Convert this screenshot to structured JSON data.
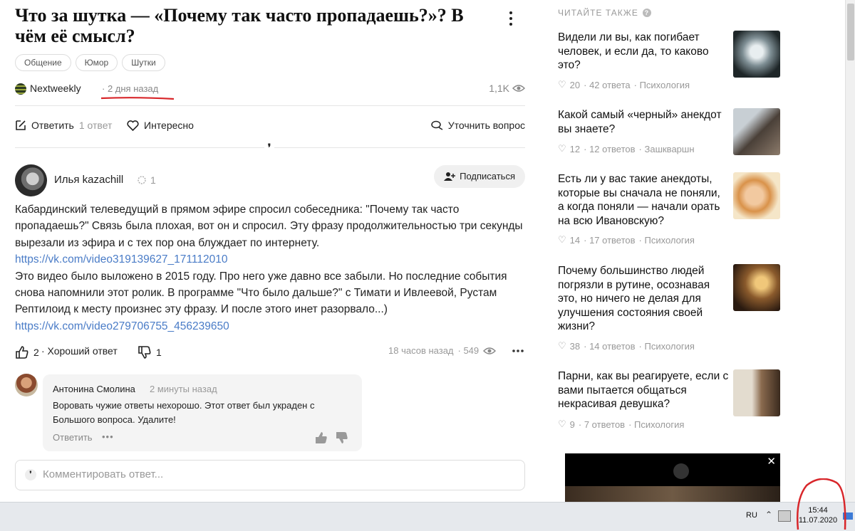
{
  "question": {
    "title": "Что за шутка — «Почему так часто пропадаешь?»? В чём её смысл?",
    "tags": [
      "Общение",
      "Юмор",
      "Шутки"
    ],
    "author": "Nextweekly",
    "time": "· 2 дня назад",
    "views": "1,1K"
  },
  "actions": {
    "answer_label": "Ответить",
    "answer_count": "1 ответ",
    "interesting_label": "Интересно",
    "clarify_label": "Уточнить вопрос"
  },
  "answer": {
    "author": "Илья kazachill",
    "rank": "1",
    "subscribe_label": "Подписаться",
    "paragraph1": "Кабардинский телеведущий в прямом эфире спросил собеседника: \"Почему так часто пропадаешь?\" Связь была плохая, вот он и спросил. Эту фразу продолжительностью три секунды вырезали из эфира и с тех пор она блуждает по интернету.",
    "link1": "https://vk.com/video319139627_171112010",
    "paragraph2": "Это видео было выложено в 2015 году. Про него уже давно все забыли. Но последние события снова напомнили этот ролик. В программе \"Что было дальше?\" с Тимати и Ивлеевой, Рустам Рептилоид к месту произнес эту фразу. И после этого инет разорвало...)",
    "link2": "https://vk.com/video279706755_456239650",
    "likes": "2",
    "good_answer_label": "· Хороший ответ",
    "dislikes": "1",
    "time": "18 часов назад",
    "views": "· 549"
  },
  "comment": {
    "author": "Антонина Смолина",
    "time": "2 минуты назад",
    "text": "Воровать чужие ответы нехорошо. Этот ответ был украден с Большого вопроса. Удалите!",
    "reply_label": "Ответить",
    "more": "•••"
  },
  "comment_input": {
    "placeholder": "Комментировать ответ..."
  },
  "sidebar": {
    "heading": "ЧИТАЙТЕ ТАКЖЕ",
    "items": [
      {
        "title": "Видели ли вы, как погибает человек, и если да, то каково это?",
        "likes": "20",
        "answers": "· 42 ответа",
        "category": "· Психология"
      },
      {
        "title": "Какой самый «черный» анекдот вы знаете?",
        "likes": "12",
        "answers": "· 12 ответов",
        "category": "· Зашкваршн"
      },
      {
        "title": "Есть ли у вас такие анекдоты, которые вы сначала не поняли, а когда поняли — начали орать на всю Ивановскую?",
        "likes": "14",
        "answers": "· 17 ответов",
        "category": "· Психология"
      },
      {
        "title": "Почему большинство людей погрязли в рутине, осознавая это, но ничего не делая для улучшения состояния своей жизни?",
        "likes": "38",
        "answers": "· 14 ответов",
        "category": "· Психология"
      },
      {
        "title": "Парни, как вы реагируете, если с вами пытается общаться некрасивая девушка?",
        "likes": "9",
        "answers": "· 7 ответов",
        "category": "· Психология"
      }
    ],
    "video_close": "✕"
  },
  "taskbar": {
    "lang": "RU",
    "time": "15:44",
    "date": "11.07.2020"
  }
}
